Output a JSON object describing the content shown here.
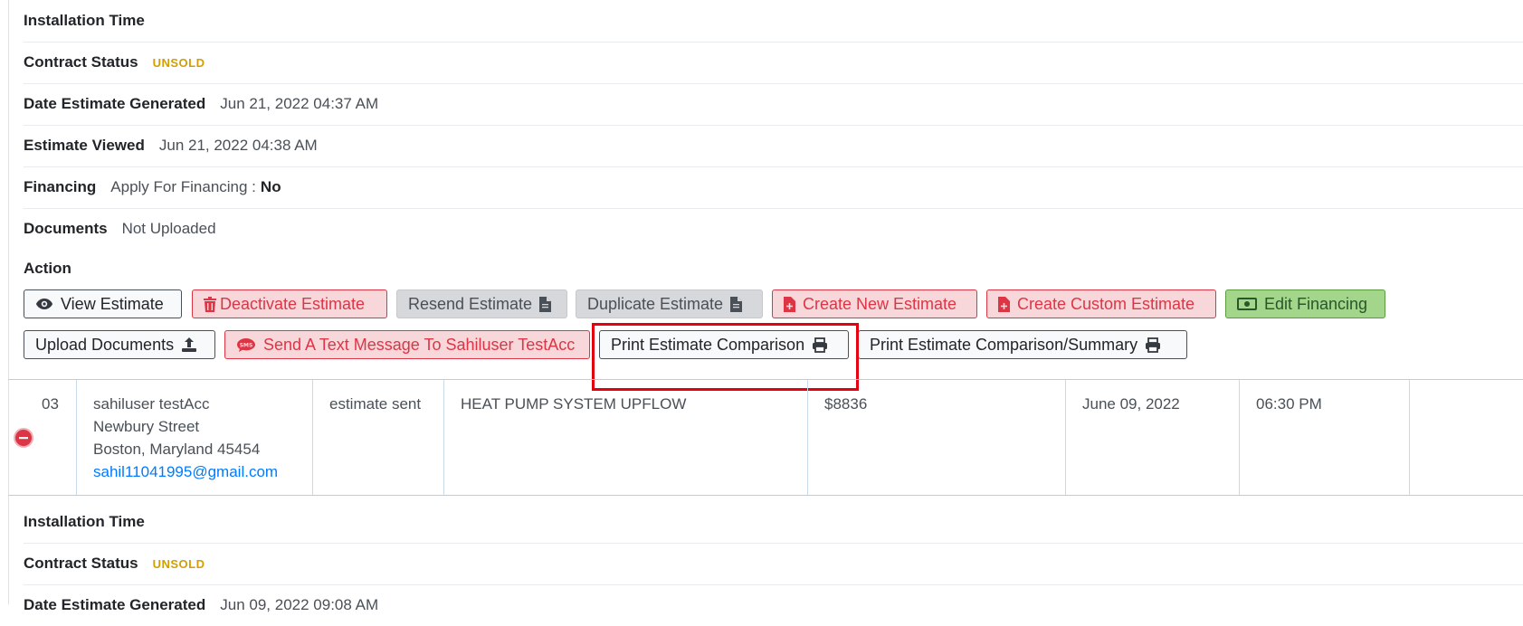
{
  "details_top": {
    "installation_time_label": "Installation Time",
    "contract_status_label": "Contract Status",
    "contract_status_value": "UNSOLD",
    "date_generated_label": "Date Estimate Generated",
    "date_generated_value": "Jun 21, 2022 04:37 AM",
    "estimate_viewed_label": "Estimate Viewed",
    "estimate_viewed_value": "Jun 21, 2022 04:38 AM",
    "financing_label": "Financing",
    "financing_text": "Apply For Financing :",
    "financing_value": "No",
    "documents_label": "Documents",
    "documents_value": "Not Uploaded",
    "action_label": "Action"
  },
  "actions": {
    "view_estimate": "View Estimate",
    "deactivate_estimate": "Deactivate Estimate",
    "resend_estimate": "Resend Estimate",
    "duplicate_estimate": "Duplicate Estimate",
    "create_new_estimate": "Create New Estimate",
    "create_custom_estimate": "Create Custom Estimate",
    "edit_financing": "Edit Financing",
    "upload_documents": "Upload Documents",
    "send_text": "Send A Text Message To Sahiluser TestAcc",
    "print_comparison": "Print Estimate Comparison",
    "print_comparison_summary": "Print Estimate Comparison/Summary"
  },
  "row": {
    "number": "03",
    "name": "sahiluser testAcc",
    "street": "Newbury Street",
    "city": "Boston, Maryland 45454",
    "email": "sahil11041995@gmail.com",
    "status": "estimate sent",
    "system": "HEAT PUMP SYSTEM UPFLOW",
    "price": "$8836",
    "date": "June 09, 2022",
    "time": "06:30 PM"
  },
  "details_bottom": {
    "installation_time_label": "Installation Time",
    "contract_status_label": "Contract Status",
    "contract_status_value": "UNSOLD",
    "date_generated_label": "Date Estimate Generated",
    "date_generated_value": "Jun 09, 2022 09:08 AM"
  },
  "colors": {
    "unsold": "#d39e00",
    "danger": "#dc3545",
    "highlight": "#e3000f",
    "link": "#007bff",
    "success": "#a3d68a"
  }
}
